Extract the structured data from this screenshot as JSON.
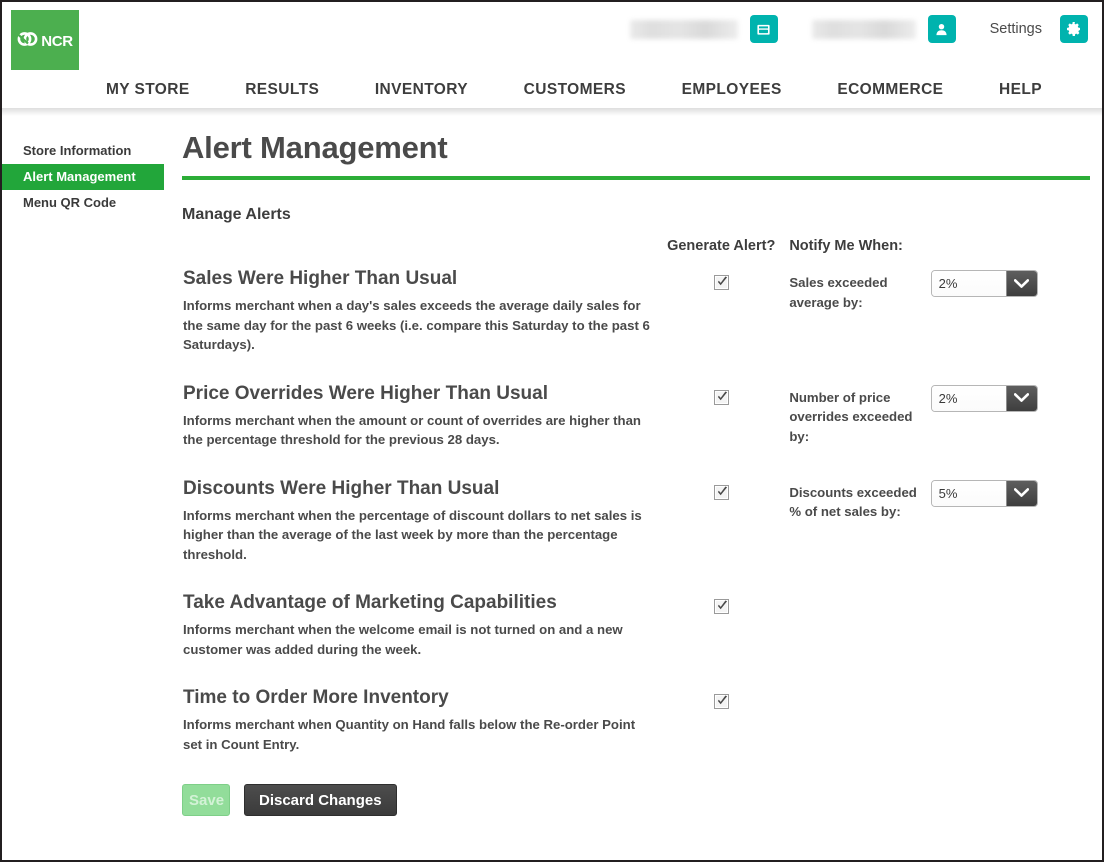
{
  "brand": {
    "logo_text": "NCR",
    "logo_color": "#4caf4f",
    "accent_color": "#2cad37",
    "teal_color": "#00b3ae"
  },
  "header": {
    "store_field_redacted": "",
    "user_field_redacted": "",
    "settings_label": "Settings",
    "store_icon": "store-icon",
    "user_icon": "user-icon",
    "gear_icon": "gear-icon"
  },
  "nav": {
    "items": [
      {
        "label": "MY STORE"
      },
      {
        "label": "RESULTS"
      },
      {
        "label": "INVENTORY"
      },
      {
        "label": "CUSTOMERS"
      },
      {
        "label": "EMPLOYEES"
      },
      {
        "label": "ECOMMERCE"
      },
      {
        "label": "HELP"
      }
    ]
  },
  "sidebar": {
    "items": [
      {
        "label": "Store Information",
        "active": false
      },
      {
        "label": "Alert Management",
        "active": true
      },
      {
        "label": "Menu QR Code",
        "active": false
      }
    ]
  },
  "main": {
    "page_title": "Alert Management",
    "section_title": "Manage Alerts",
    "columns": {
      "description": "",
      "generate_alert": "Generate Alert?",
      "notify_me_when": "Notify Me When:",
      "threshold": ""
    },
    "alerts": [
      {
        "title": "Sales Were Higher Than Usual",
        "description": "Informs merchant when a day's sales exceeds the average daily sales for the same day for the past 6 weeks (i.e. compare this Saturday to the past 6 Saturdays).",
        "generate_alert": true,
        "notify_label": "Sales exceeded average by:",
        "threshold_value": "2%",
        "has_threshold": true
      },
      {
        "title": "Price Overrides Were Higher Than Usual",
        "description": "Informs merchant when the amount or count of overrides are higher than the percentage threshold for the previous 28 days.",
        "generate_alert": true,
        "notify_label": "Number of price overrides exceeded by:",
        "threshold_value": "2%",
        "has_threshold": true
      },
      {
        "title": "Discounts Were Higher Than Usual",
        "description": "Informs merchant when the percentage of discount dollars to net sales is higher than the average of the last week by more than the percentage threshold.",
        "generate_alert": true,
        "notify_label": "Discounts exceeded % of net sales by:",
        "threshold_value": "5%",
        "has_threshold": true
      },
      {
        "title": "Take Advantage of Marketing Capabilities",
        "description": "Informs merchant when the welcome email is not turned on and a new customer was added during the week.",
        "generate_alert": true,
        "notify_label": "",
        "threshold_value": "",
        "has_threshold": false
      },
      {
        "title": "Time to Order More Inventory",
        "description": "Informs merchant when Quantity on Hand falls below the Re-order Point set in Count Entry.",
        "generate_alert": true,
        "notify_label": "",
        "threshold_value": "",
        "has_threshold": false
      }
    ],
    "buttons": {
      "save_label": "Save",
      "save_disabled": true,
      "discard_label": "Discard Changes"
    }
  }
}
